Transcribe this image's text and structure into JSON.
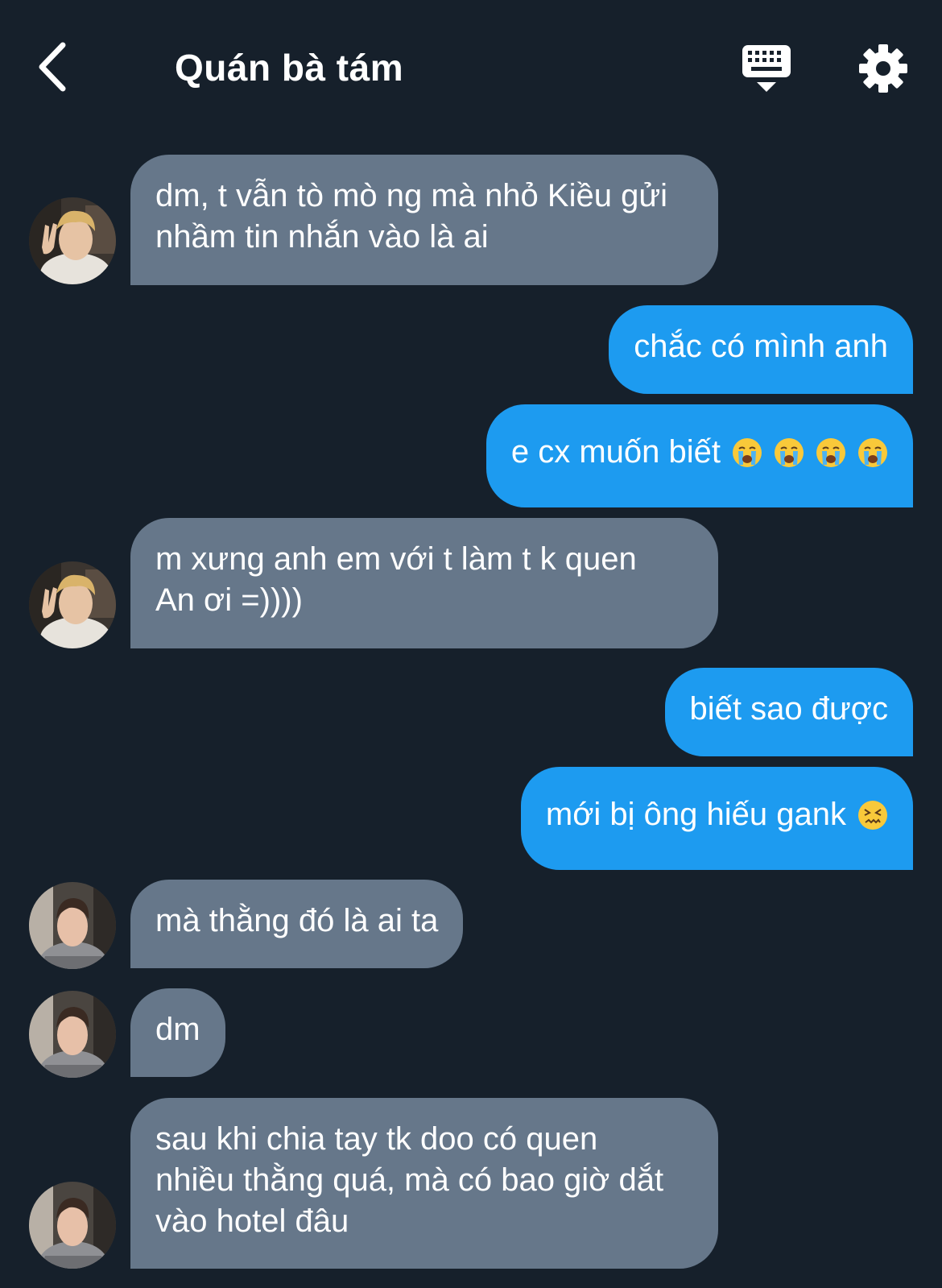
{
  "header": {
    "title": "Quán bà tám",
    "back_icon": "chevron-left-icon",
    "keyboard_icon": "keyboard-icon",
    "settings_icon": "gear-icon"
  },
  "colors": {
    "background": "#16202b",
    "incoming_bubble": "#66778a",
    "outgoing_bubble": "#1d9bf0"
  },
  "messages": [
    {
      "side": "incoming",
      "sender_avatar": "avatar-1",
      "lines": [
        "dm, t vẫn tò mò ng mà nhỏ Kiều gửi",
        "nhầm tin nhắn vào là ai"
      ]
    },
    {
      "side": "outgoing",
      "lines": [
        "chắc có mình anh"
      ]
    },
    {
      "side": "outgoing",
      "text": "e cx muốn biết",
      "emojis": [
        "loudly-crying-face",
        "loudly-crying-face",
        "loudly-crying-face",
        "loudly-crying-face"
      ]
    },
    {
      "side": "incoming",
      "sender_avatar": "avatar-1",
      "lines": [
        "m xưng anh em với t làm t k quen",
        "An ơi =))))"
      ]
    },
    {
      "side": "outgoing",
      "lines": [
        "biết sao được"
      ]
    },
    {
      "side": "outgoing",
      "text": "mới bị ông hiếu gank",
      "emojis": [
        "confounded-face"
      ]
    },
    {
      "side": "incoming",
      "sender_avatar": "avatar-2",
      "lines": [
        "mà thằng đó là ai ta"
      ]
    },
    {
      "side": "incoming",
      "sender_avatar": "avatar-2",
      "lines": [
        "dm"
      ]
    },
    {
      "side": "incoming",
      "sender_avatar": "avatar-2",
      "lines": [
        "sau khi chia tay tk doo có quen",
        "nhiều thằng quá, mà có bao giờ dắt",
        "vào hotel đâu"
      ]
    }
  ]
}
